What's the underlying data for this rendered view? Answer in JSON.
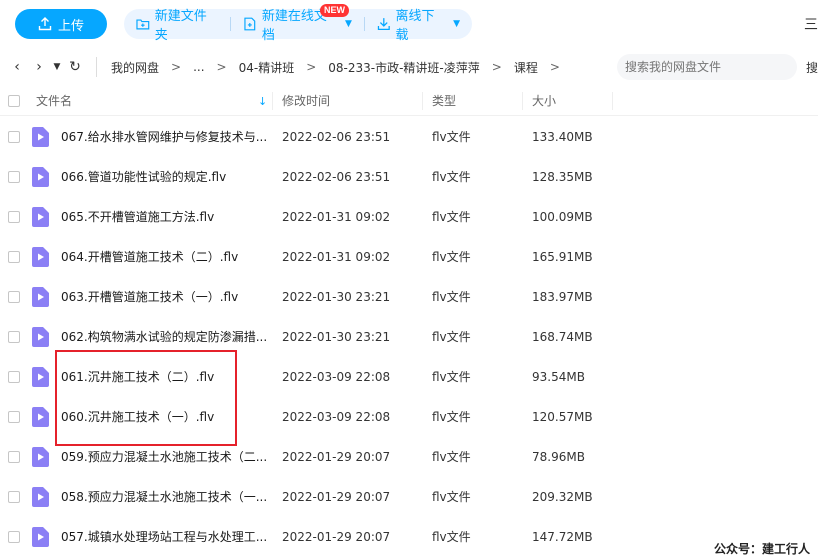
{
  "toolbar": {
    "upload_label": "上传",
    "new_folder_label": "新建文件夹",
    "new_doc_label": "新建在线文档",
    "new_badge": "NEW",
    "offline_label": "离线下载",
    "menu_icon": "三"
  },
  "navbar": {
    "crumbs": [
      "我的网盘",
      "...",
      "04-精讲班",
      "08-233-市政-精讲班-凌萍萍",
      "课程"
    ],
    "search_placeholder": "搜索我的网盘文件",
    "search_btn": "搜"
  },
  "columns": {
    "name": "文件名",
    "time": "修改时间",
    "type": "类型",
    "size": "大小"
  },
  "files": [
    {
      "name": "067.给水排水管网维护与修复技术与...",
      "time": "2022-02-06 23:51",
      "type": "flv文件",
      "size": "133.40MB"
    },
    {
      "name": "066.管道功能性试验的规定.flv",
      "time": "2022-02-06 23:51",
      "type": "flv文件",
      "size": "128.35MB"
    },
    {
      "name": "065.不开槽管道施工方法.flv",
      "time": "2022-01-31 09:02",
      "type": "flv文件",
      "size": "100.09MB"
    },
    {
      "name": "064.开槽管道施工技术（二）.flv",
      "time": "2022-01-31 09:02",
      "type": "flv文件",
      "size": "165.91MB"
    },
    {
      "name": "063.开槽管道施工技术（一）.flv",
      "time": "2022-01-30 23:21",
      "type": "flv文件",
      "size": "183.97MB"
    },
    {
      "name": "062.构筑物满水试验的规定防渗漏措...",
      "time": "2022-01-30 23:21",
      "type": "flv文件",
      "size": "168.74MB"
    },
    {
      "name": "061.沉井施工技术（二）.flv",
      "time": "2022-03-09 22:08",
      "type": "flv文件",
      "size": "93.54MB"
    },
    {
      "name": "060.沉井施工技术（一）.flv",
      "time": "2022-03-09 22:08",
      "type": "flv文件",
      "size": "120.57MB"
    },
    {
      "name": "059.预应力混凝土水池施工技术（二...",
      "time": "2022-01-29 20:07",
      "type": "flv文件",
      "size": "78.96MB"
    },
    {
      "name": "058.预应力混凝土水池施工技术（一...",
      "time": "2022-01-29 20:07",
      "type": "flv文件",
      "size": "209.32MB"
    },
    {
      "name": "057.城镇水处理场站工程与水处理工...",
      "time": "2022-01-29 20:07",
      "type": "flv文件",
      "size": "147.72MB"
    }
  ],
  "watermark": "公众号：建工行人",
  "colors": {
    "accent": "#06a7ff",
    "highlight_box": "#e5212b",
    "file_icon": "#8b7ff5"
  }
}
